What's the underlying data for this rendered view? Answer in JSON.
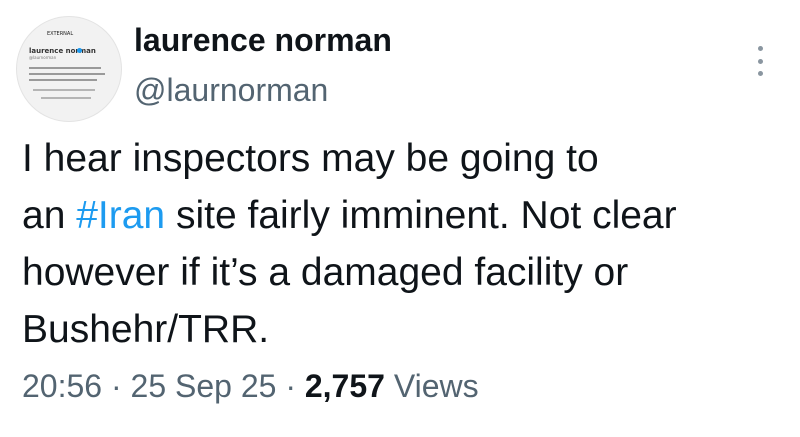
{
  "author": {
    "display_name": "laurence norman",
    "handle": "@laurnorman",
    "avatar": {
      "top_text": "EXTERNAL",
      "name_text": "laurence norman",
      "handle_text": "@laurnorman"
    }
  },
  "tweet": {
    "lines": [
      {
        "text": "I hear inspectors may be going to"
      },
      {
        "prefix": "an ",
        "hashtag": "#Iran",
        "suffix": " site fairly imminent. Not clear"
      },
      {
        "text": "however if it’s a damaged facility or"
      },
      {
        "text": "Bushehr/TRR."
      }
    ]
  },
  "meta": {
    "time": "20:56",
    "separator": "·",
    "date": "25 Sep 25",
    "views_count": "2,757",
    "views_label": "Views"
  },
  "icons": {
    "more": "more-vertical-icon",
    "verified": "verified-badge-icon"
  },
  "colors": {
    "text": "#0f1419",
    "secondary": "#536471",
    "link": "#1d9bf0"
  }
}
